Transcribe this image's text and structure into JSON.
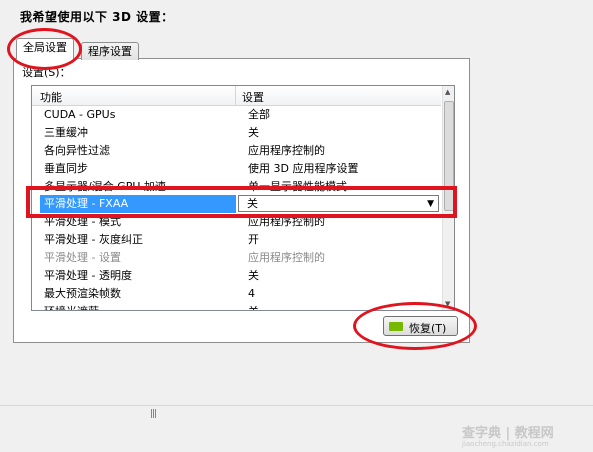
{
  "heading": "我希望使用以下 3D 设置：",
  "tabs": [
    {
      "label": "全局设置",
      "active": true
    },
    {
      "label": "程序设置",
      "active": false
    }
  ],
  "settings_label": "设置(S)：",
  "columns": {
    "feature": "功能",
    "setting": "设置"
  },
  "rows": [
    {
      "feature": "CUDA - GPUs",
      "value": "全部"
    },
    {
      "feature": "三重缓冲",
      "value": "关"
    },
    {
      "feature": "各向异性过滤",
      "value": "应用程序控制的"
    },
    {
      "feature": "垂直同步",
      "value": "使用 3D 应用程序设置"
    },
    {
      "feature": "多显示器/混合 GPU 加速",
      "value": "单一显示器性能模式"
    },
    {
      "feature": "平滑处理 - FXAA",
      "value": "关",
      "selected": true
    },
    {
      "feature": "平滑处理 - 模式",
      "value": "应用程序控制的"
    },
    {
      "feature": "平滑处理 - 灰度纠正",
      "value": "开"
    },
    {
      "feature": "平滑处理 - 设置",
      "value": "应用程序控制的",
      "disabled": true
    },
    {
      "feature": "平滑处理 - 透明度",
      "value": "关"
    },
    {
      "feature": "最大预渲染帧数",
      "value": "4"
    },
    {
      "feature": "环境光遮蔽",
      "value": "关"
    }
  ],
  "restore_button": "恢复(T)",
  "watermark": "查字典 | 教程网",
  "watermark_sub": "jiaocheng.chazidian.com",
  "colors": {
    "selection": "#3399ff",
    "annotation": "#e0141e",
    "nvidia_green": "#76b900"
  },
  "icons": {
    "dropdown": "chevron-down-icon",
    "logo": "nvidia-logo-icon"
  }
}
